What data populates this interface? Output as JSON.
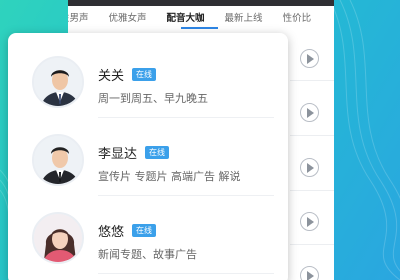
{
  "tabs": [
    {
      "label": "性男声",
      "active": false
    },
    {
      "label": "优雅女声",
      "active": false
    },
    {
      "label": "配音大咖",
      "active": true
    },
    {
      "label": "最新上线",
      "active": false
    },
    {
      "label": "性价比",
      "active": false
    }
  ],
  "voice_actors": [
    {
      "name": "关关",
      "badge": "在线",
      "desc": "周一到周五、早九晚五"
    },
    {
      "name": "李显达",
      "badge": "在线",
      "desc": "宣传片 专题片 高端广告 解说"
    },
    {
      "name": "悠悠",
      "badge": "在线",
      "desc": "新闻专题、故事广告"
    }
  ],
  "colors": {
    "accent": "#2e86e6",
    "badge": "#3ba0ea",
    "bg_start": "#2fd3bd",
    "bg_end": "#2aa6e0"
  }
}
